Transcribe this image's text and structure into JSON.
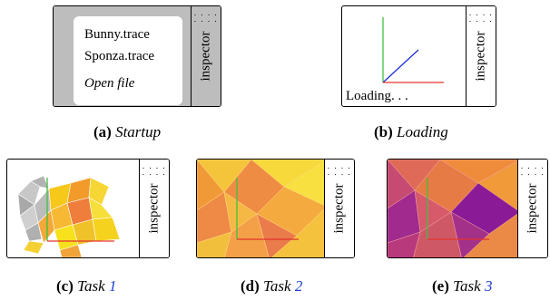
{
  "panels": {
    "startup": {
      "inspector_label": "inspector",
      "menu": {
        "file1": "Bunny.trace",
        "file2": "Sponza.trace",
        "open": "Open file"
      }
    },
    "loading": {
      "inspector_label": "inspector",
      "status": "Loading. . ."
    },
    "task1": {
      "inspector_label": "inspector"
    },
    "task2": {
      "inspector_label": "inspector"
    },
    "task3": {
      "inspector_label": "inspector"
    }
  },
  "dots": ". . . .\n. . . .",
  "captions": {
    "a": {
      "letter": "(a)",
      "title": "Startup"
    },
    "b": {
      "letter": "(b)",
      "title": "Loading"
    },
    "c": {
      "letter": "(c)",
      "title": "Task",
      "num": "1"
    },
    "d": {
      "letter": "(d)",
      "title": "Task",
      "num": "2"
    },
    "e": {
      "letter": "(e)",
      "title": "Task",
      "num": "3"
    }
  },
  "colors": {
    "axis_x": "#e3342f",
    "axis_y": "#3ec13e",
    "axis_z": "#1f2fd6",
    "link_number": "#1f3fd6",
    "startup_background": "#bdbdbd"
  }
}
